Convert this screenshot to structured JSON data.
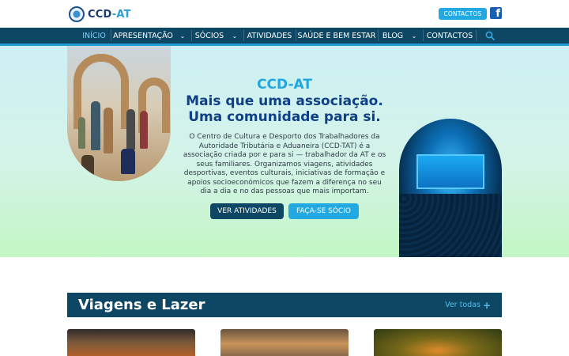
{
  "brand": {
    "prefix": "CCD",
    "dash": "-",
    "suffix": "AT"
  },
  "top": {
    "contact_label": "CONTACTOS",
    "facebook_glyph": "f"
  },
  "nav": {
    "items": [
      {
        "label": "INÍCIO",
        "active": true,
        "has_dropdown": false
      },
      {
        "label": "APRESENTAÇÃO",
        "active": false,
        "has_dropdown": true
      },
      {
        "label": "SÓCIOS",
        "active": false,
        "has_dropdown": true
      },
      {
        "label": "ATIVIDADES",
        "active": false,
        "has_dropdown": false
      },
      {
        "label": "SAÚDE E BEM ESTAR",
        "active": false,
        "has_dropdown": false
      },
      {
        "label": "BLOG",
        "active": false,
        "has_dropdown": true
      },
      {
        "label": "CONTACTOS",
        "active": false,
        "has_dropdown": false
      }
    ],
    "chevron_glyph": "⌄"
  },
  "hero": {
    "title": "CCD-AT",
    "subtitle_line1": "Mais que uma associação.",
    "subtitle_line2": "Uma comunidade para si.",
    "text": "O Centro de Cultura e Desporto dos Trabalhadores da Autoridade Tributária e Aduaneira (CCD-TAT) é a associação criada por e para si — trabalhador da AT e os seus familiares. Organizamos viagens, atividades desportivas, eventos culturais, iniciativas de formação e apoios socioeconómicos que fazem a diferença no seu dia a dia e no das pessoas que mais importam.",
    "btn_primary": "VER ATIVIDADES",
    "btn_secondary": "FAÇA-SE SÓCIO"
  },
  "section": {
    "title": "Viagens e Lazer",
    "link_label": "Ver todas",
    "link_icon": "+"
  },
  "colors": {
    "navy": "#0e4764",
    "accent": "#23a9e1",
    "title_blue": "#0f3f86"
  }
}
